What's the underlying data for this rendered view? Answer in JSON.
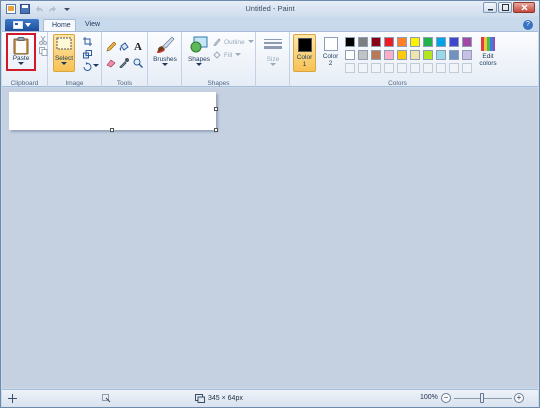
{
  "window": {
    "title": "Untitled - Paint"
  },
  "tabs": [
    {
      "label": "Home"
    },
    {
      "label": "View"
    }
  ],
  "ribbon": {
    "clipboard": {
      "paste_label": "Paste",
      "group_label": "Clipboard"
    },
    "image": {
      "select_label": "Select",
      "group_label": "Image"
    },
    "tools": {
      "group_label": "Tools"
    },
    "brushes": {
      "label": "Brushes"
    },
    "shapes": {
      "shapes_label": "Shapes",
      "outline_label": "Outline",
      "fill_label": "Fill",
      "group_label": "Shapes"
    },
    "size": {
      "label": "Size"
    },
    "colors": {
      "color1_label": "Color",
      "color1_num": "1",
      "color2_label": "Color",
      "color2_num": "2",
      "edit_label": "Edit colors",
      "group_label": "Colors",
      "color1_value": "#000000",
      "color2_value": "#ffffff",
      "row1": [
        "#000000",
        "#7f7f7f",
        "#880015",
        "#ed1c24",
        "#ff7f27",
        "#fff200",
        "#22b14c",
        "#00a2e8",
        "#3f48cc",
        "#a349a4"
      ],
      "row2": [
        "#ffffff",
        "#c3c3c3",
        "#b97a57",
        "#ffaec9",
        "#ffc90e",
        "#efe4b0",
        "#b5e61d",
        "#99d9ea",
        "#7092be",
        "#c8bfe7"
      ]
    }
  },
  "status": {
    "image_size": "345 × 64px",
    "zoom": "100%"
  }
}
